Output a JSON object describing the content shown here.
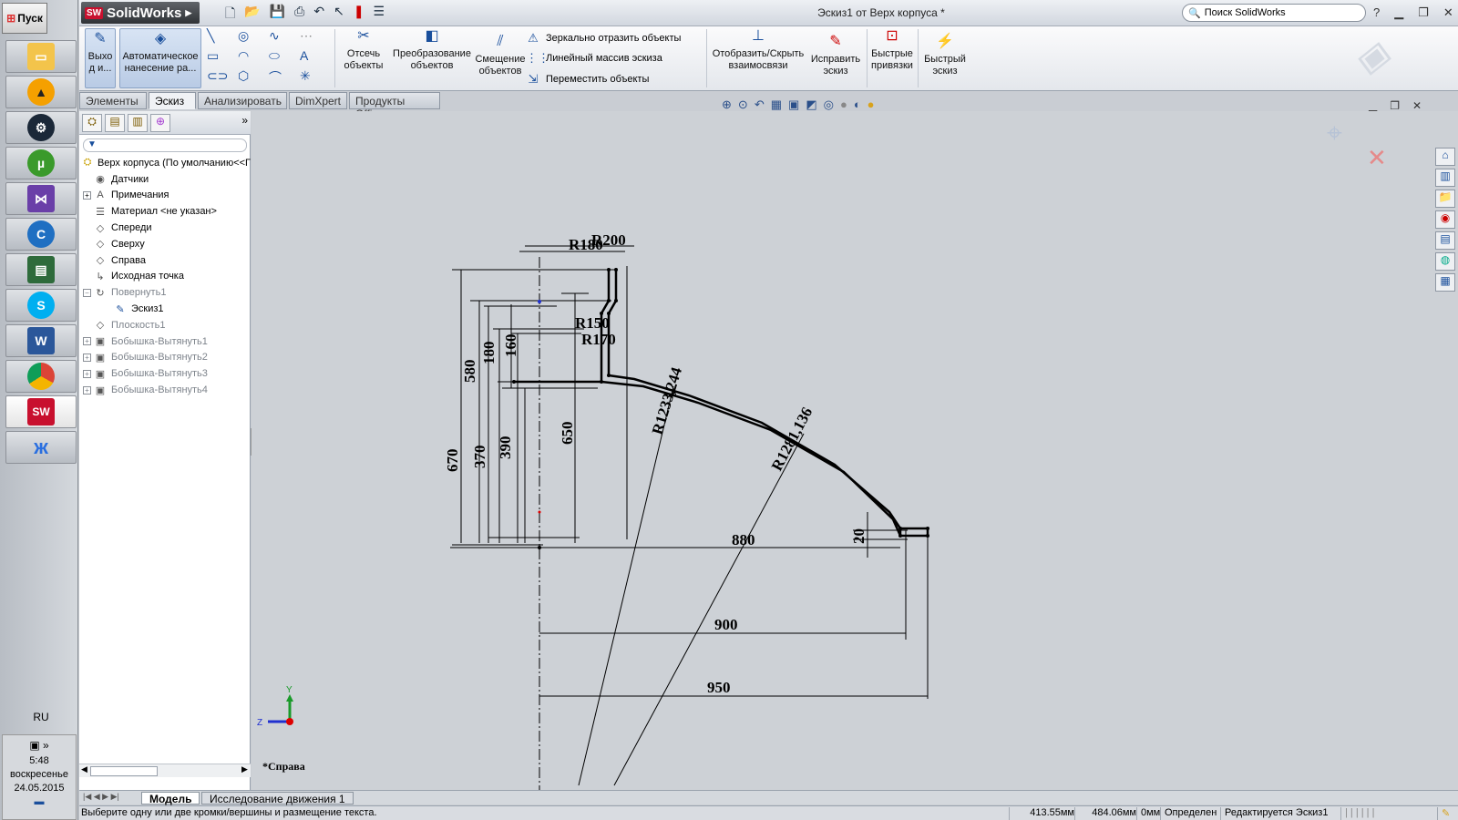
{
  "taskbar": {
    "start_label": "Пуск",
    "lang": "RU",
    "clock_time": "5:48",
    "clock_day": "воскресенье",
    "clock_date": "24.05.2015"
  },
  "app": {
    "logo": "SolidWorks",
    "window_title": "Эскиз1 от Верх корпуса *",
    "search_placeholder": "Поиск SolidWorks"
  },
  "ribbon": {
    "exit_label": "Выхо д и...",
    "auto_dim_label": "Автоматическое нанесение ра...",
    "trim_label": "Отсечь объекты",
    "convert_label": "Преобразование объектов",
    "offset_label": "Смещение объектов",
    "mirror_label": "Зеркально отразить объекты",
    "linear_pattern_label": "Линейный массив эскиза",
    "move_label": "Переместить объекты",
    "relations_label": "Отобразить/Скрыть взаимосвязи",
    "repair_label": "Исправить эскиз",
    "quick_snaps_label": "Быстрые привязки",
    "rapid_sketch_label": "Быстрый эскиз"
  },
  "tabs": [
    "Элементы",
    "Эскиз",
    "Анализировать",
    "DimXpert",
    "Продукты Office"
  ],
  "feature_tree": {
    "root": "Верх корпуса  (По умолчанию<<Г",
    "items": [
      {
        "label": "Датчики",
        "icon": "sensor-icon",
        "expand": false,
        "gray": false,
        "indent": 1
      },
      {
        "label": "Примечания",
        "icon": "annotation-icon",
        "expand": true,
        "gray": false,
        "indent": 1
      },
      {
        "label": "Материал <не указан>",
        "icon": "material-icon",
        "expand": false,
        "gray": false,
        "indent": 1
      },
      {
        "label": "Спереди",
        "icon": "plane-icon",
        "expand": false,
        "gray": false,
        "indent": 1
      },
      {
        "label": "Сверху",
        "icon": "plane-icon",
        "expand": false,
        "gray": false,
        "indent": 1
      },
      {
        "label": "Справа",
        "icon": "plane-icon",
        "expand": false,
        "gray": false,
        "indent": 1
      },
      {
        "label": "Исходная точка",
        "icon": "origin-icon",
        "expand": false,
        "gray": false,
        "indent": 1
      },
      {
        "label": "Повернуть1",
        "icon": "revolve-icon",
        "expand": true,
        "gray": true,
        "indent": 1
      },
      {
        "label": "Эскиз1",
        "icon": "sketch-icon",
        "expand": false,
        "gray": false,
        "indent": 2
      },
      {
        "label": "Плоскость1",
        "icon": "plane-icon",
        "expand": false,
        "gray": true,
        "indent": 1
      },
      {
        "label": "Бобышка-Вытянуть1",
        "icon": "extrude-icon",
        "expand": true,
        "gray": true,
        "indent": 1
      },
      {
        "label": "Бобышка-Вытянуть2",
        "icon": "extrude-icon",
        "expand": true,
        "gray": true,
        "indent": 1
      },
      {
        "label": "Бобышка-Вытянуть3",
        "icon": "extrude-icon",
        "expand": true,
        "gray": true,
        "indent": 1
      },
      {
        "label": "Бобышка-Вытянуть4",
        "icon": "extrude-icon",
        "expand": true,
        "gray": true,
        "indent": 1
      }
    ]
  },
  "sketch": {
    "view_label": "*Справа",
    "dims": {
      "r200": "R200",
      "r180": "R180",
      "r150": "R150",
      "r170": "R170",
      "r1233": "R1233,244",
      "r1281": "R1281,136",
      "d580": "580",
      "d180": "180",
      "d160": "160",
      "d650": "650",
      "d670": "670",
      "d370": "370",
      "d390": "390",
      "d880": "880",
      "d900": "900",
      "d950": "950",
      "d20": "20"
    },
    "axis_y": "Y",
    "axis_z": "Z"
  },
  "bottom_tabs": [
    "Модель",
    "Исследование движения 1"
  ],
  "status": {
    "hint": "Выберите одну или две кромки/вершины и размещение текста.",
    "x": "413.55мм",
    "y": "484.06мм",
    "z": "0мм",
    "state": "Определен",
    "editing": "Редактируется Эскиз1"
  }
}
